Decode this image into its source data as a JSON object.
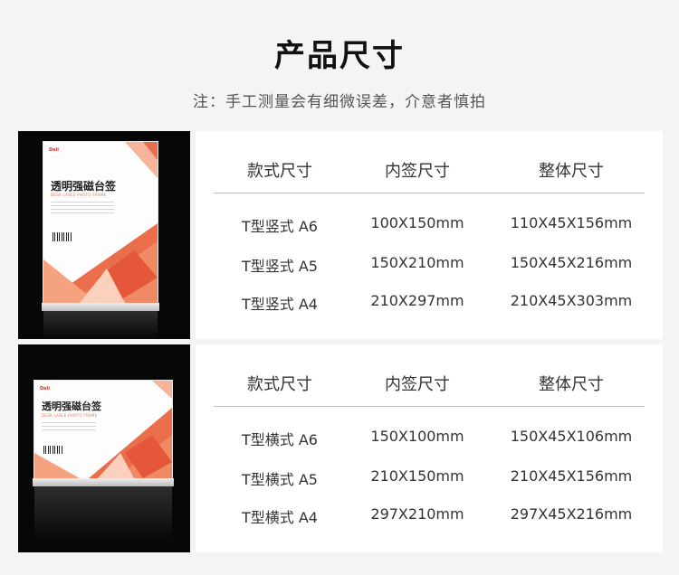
{
  "page": {
    "title": "产品尺寸",
    "note": "注：手工测量会有细微误差，介意者慎拍"
  },
  "vertical": {
    "headers": [
      "款式尺寸",
      "内签尺寸",
      "整体尺寸"
    ],
    "rows": [
      [
        "T型竖式 A6",
        "100X150mm",
        "110X45X156mm"
      ],
      [
        "T型竖式 A5",
        "150X210mm",
        "150X45X216mm"
      ],
      [
        "T型竖式 A4",
        "210X297mm",
        "210X45X303mm"
      ]
    ],
    "product": {
      "brand": "Deli",
      "name": "透明强磁台签",
      "english": "DESK LABLE PHOTO FRAME"
    }
  },
  "horizontal": {
    "headers": [
      "款式尺寸",
      "内签尺寸",
      "整体尺寸"
    ],
    "rows": [
      [
        "T型横式 A6",
        "150X100mm",
        "150X45X106mm"
      ],
      [
        "T型横式 A5",
        "210X150mm",
        "210X45X156mm"
      ],
      [
        "T型横式 A4",
        "297X210mm",
        "297X45X216mm"
      ]
    ],
    "product": {
      "brand": "Deli",
      "name": "透明强磁台签",
      "english": "DESK LABLE PHOTO FRAME"
    }
  },
  "colors": {
    "accent": "#ea6d4c",
    "accent_light": "#f4a27f",
    "background": "#f4f4f4",
    "photo_bg": "#070707"
  }
}
